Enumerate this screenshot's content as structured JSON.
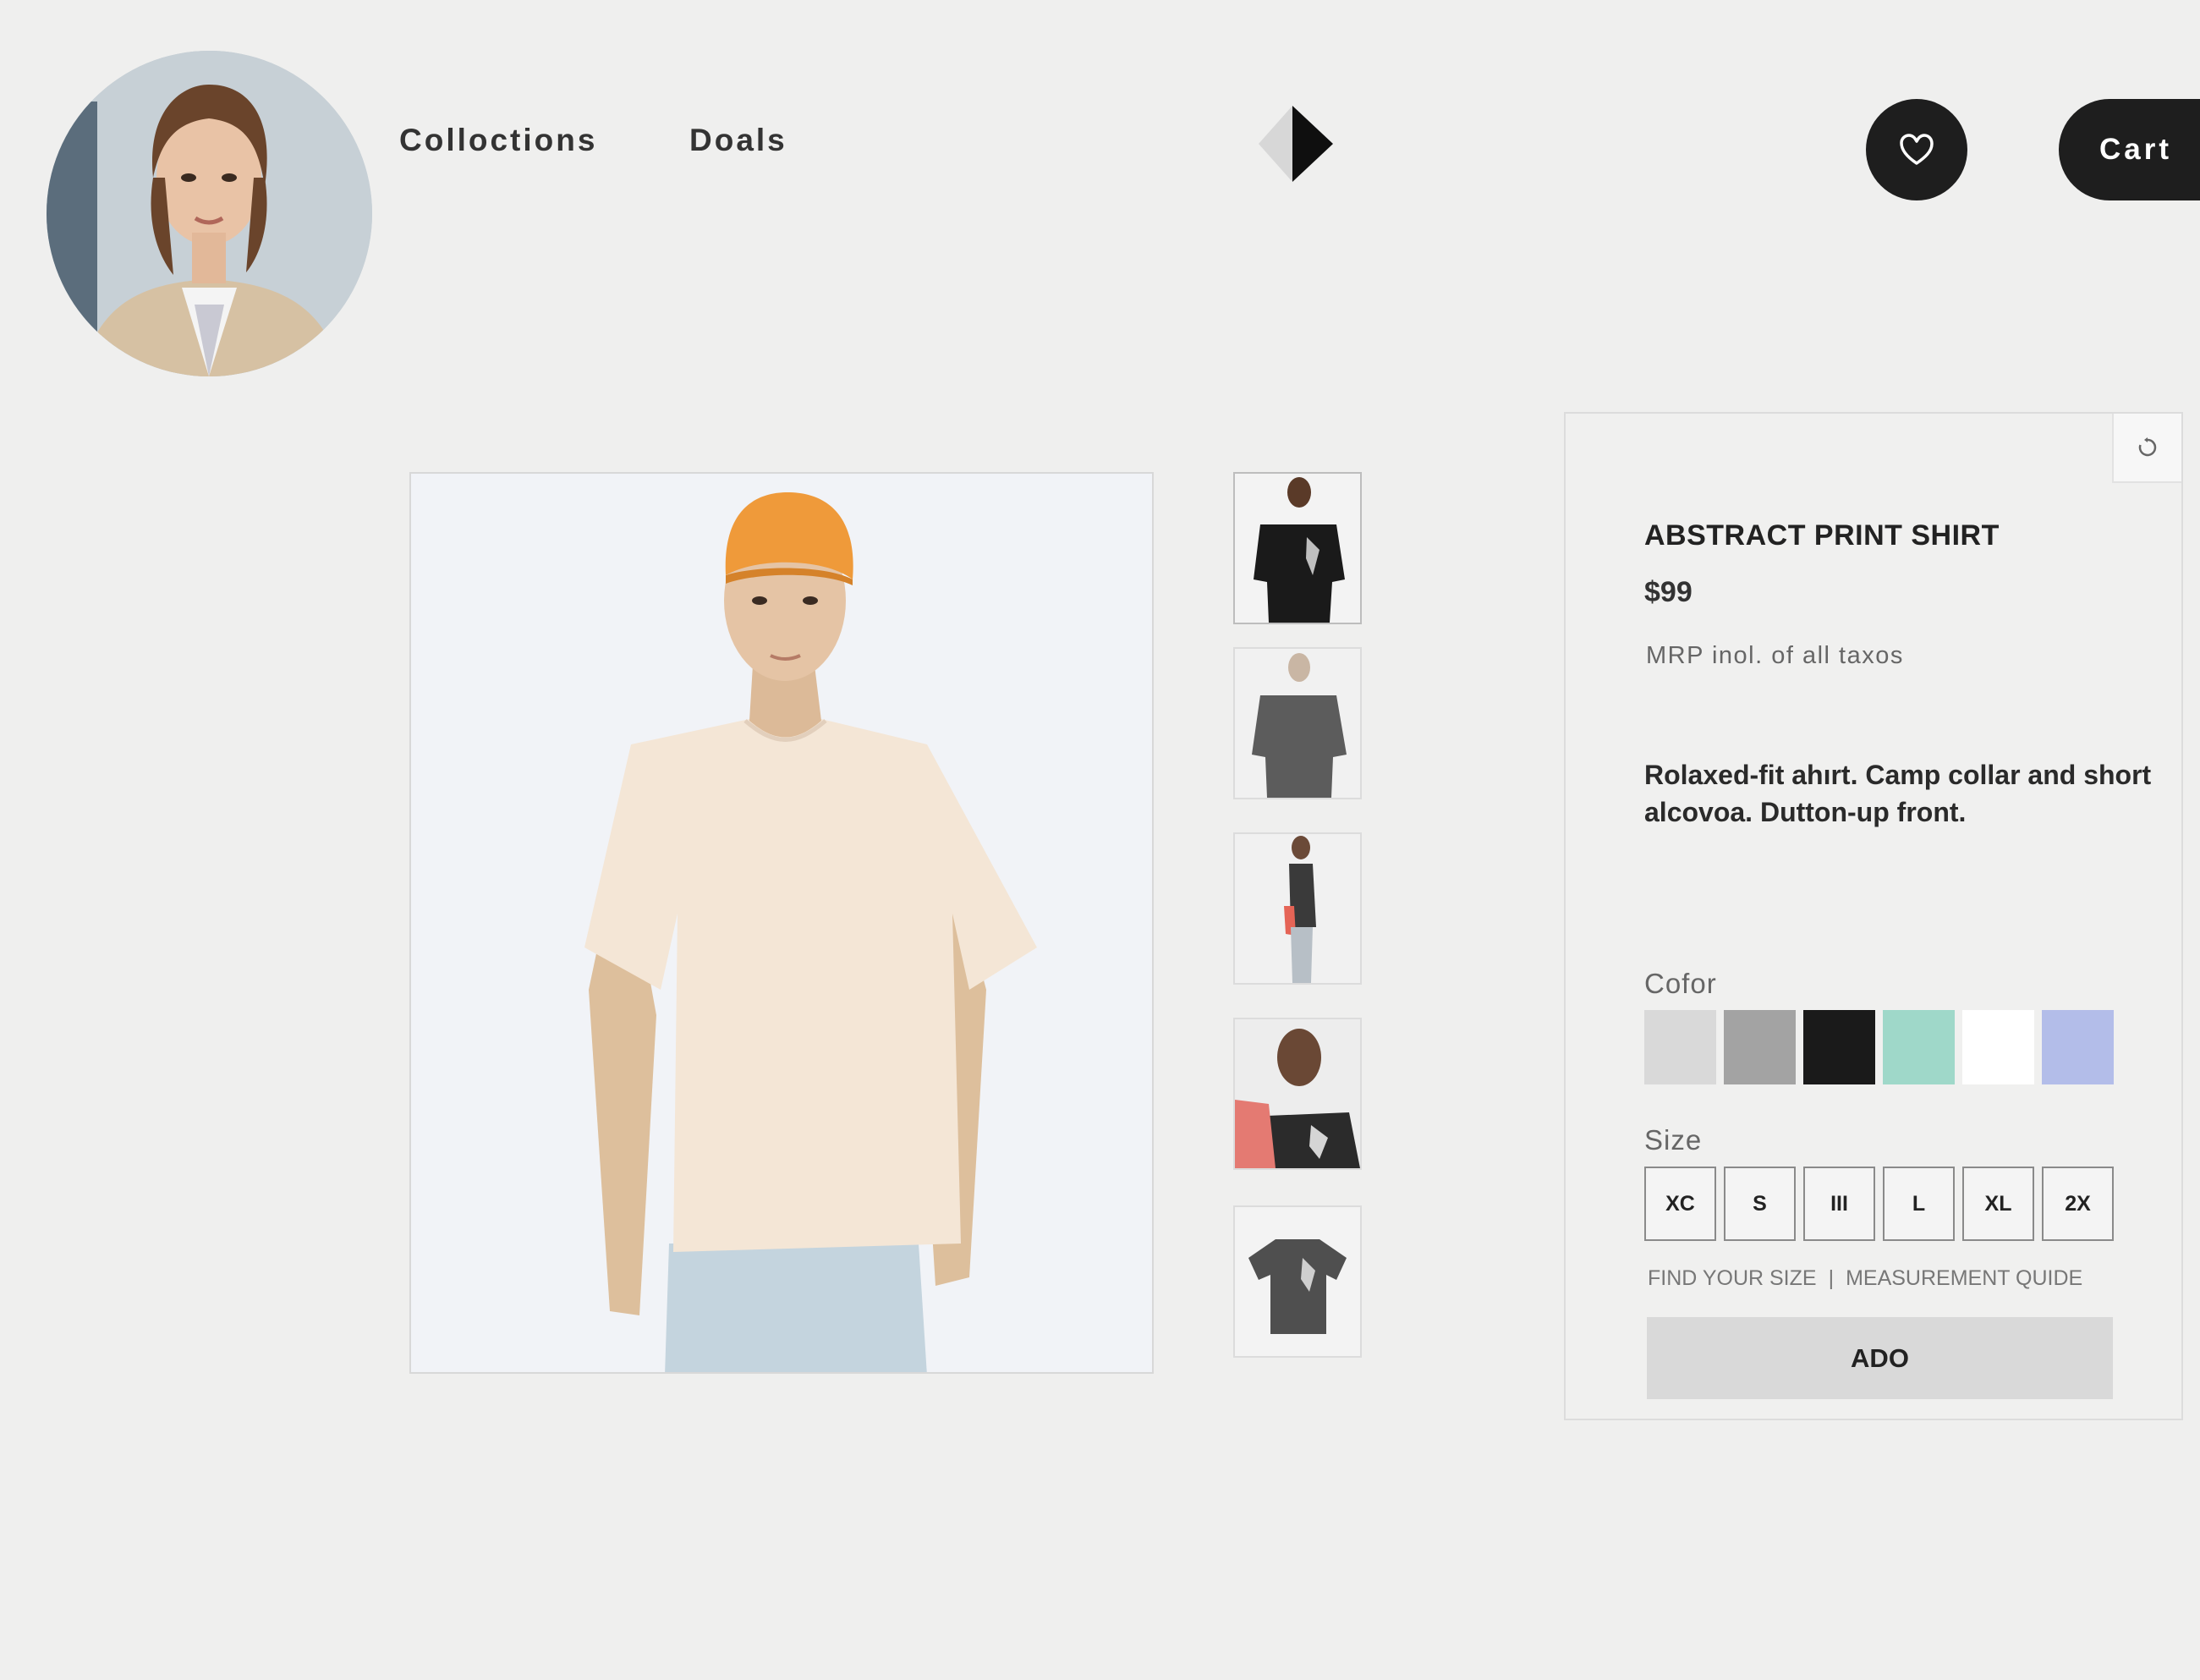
{
  "header": {
    "nav": [
      {
        "label": "Colloctions"
      },
      {
        "label": "Doals"
      }
    ],
    "cart_label": "Cart",
    "avatar_icon": "user-avatar",
    "wishlist_icon": "heart-icon",
    "logo_icon": "diamond-logo"
  },
  "gallery": {
    "main_image": "model-cream-tshirt-orange-cap",
    "thumbnails": [
      {
        "icon": "model-front-black-shirt"
      },
      {
        "icon": "model-back-grey-shirt"
      },
      {
        "icon": "model-side-view"
      },
      {
        "icon": "model-closeup-with-jacket"
      },
      {
        "icon": "shirt-flat-lay"
      }
    ]
  },
  "product": {
    "title": "ABSTRACT PRINT SHIRT",
    "price": "$99",
    "tax_note": "MRP inol. of all taxos",
    "description": "Rolaxed-fit ahırt. Camp collar and short alcovoa. Dutton-up front.",
    "color_label": "Cofor",
    "colors": [
      "#d9d9d9",
      "#a3a3a3",
      "#1a1a1a",
      "#9fd8c9",
      "#ffffff",
      "#b3bde9"
    ],
    "size_label": "Size",
    "sizes": [
      "XC",
      "S",
      "III",
      "L",
      "XL",
      "2X"
    ],
    "find_size": "FIND YOUR SIZE",
    "separator": "|",
    "measurement_guide": "MEASUREMENT QUIDE",
    "add_label": "ADO",
    "corner_icon": "refresh-icon"
  }
}
